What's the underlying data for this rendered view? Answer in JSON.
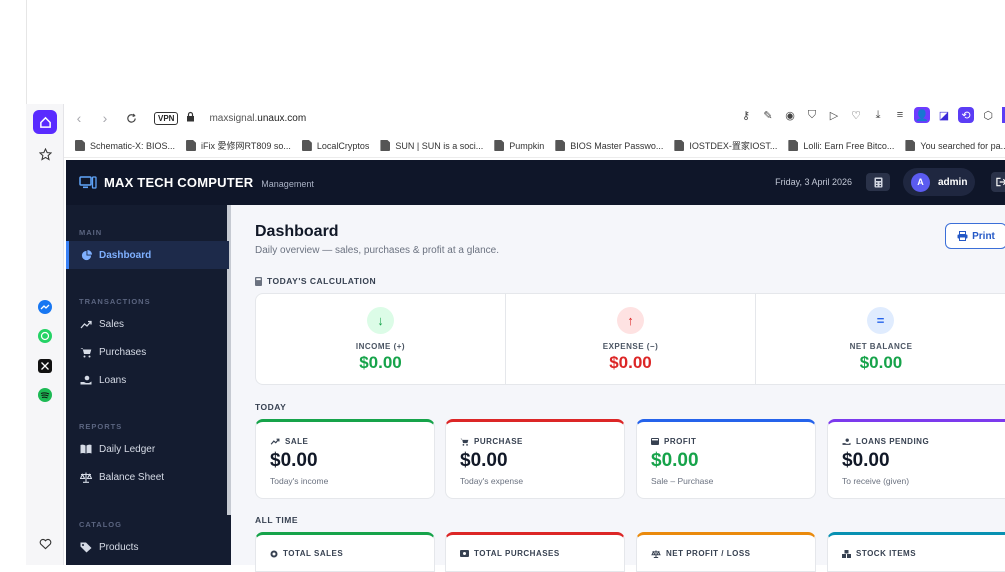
{
  "browser": {
    "vpn_label": "VPN",
    "url_prefix": "maxsignal.",
    "url_domain": "unaux.com",
    "bookmarks": [
      {
        "label": "Schematic-X: BIOS..."
      },
      {
        "label": "iFix 愛修网RT809 so..."
      },
      {
        "label": "LocalCryptos"
      },
      {
        "label": "SUN | SUN is a soci..."
      },
      {
        "label": "Pumpkin"
      },
      {
        "label": "BIOS Master Passwo..."
      },
      {
        "label": "IOSTDEX-置家IOST..."
      },
      {
        "label": "Lolli: Earn Free Bitco..."
      },
      {
        "label": "You searched for pa..."
      }
    ]
  },
  "header": {
    "brand": "MAX TECH COMPUTER",
    "brand_sub": "Management",
    "date": "Friday, 3 April 2026",
    "avatar_letter": "A",
    "username": "admin"
  },
  "sidebar": {
    "sections": {
      "main": "MAIN",
      "transactions": "TRANSACTIONS",
      "reports": "REPORTS",
      "catalog": "CATALOG"
    },
    "items": [
      {
        "label": "Dashboard",
        "icon": "pie-chart-icon",
        "active": true
      },
      {
        "label": "Sales",
        "icon": "trend-up-icon"
      },
      {
        "label": "Purchases",
        "icon": "cart-icon"
      },
      {
        "label": "Loans",
        "icon": "hand-coin-icon"
      },
      {
        "label": "Daily Ledger",
        "icon": "book-icon"
      },
      {
        "label": "Balance Sheet",
        "icon": "scale-icon"
      },
      {
        "label": "Products",
        "icon": "tag-icon"
      }
    ]
  },
  "main": {
    "title": "Dashboard",
    "subtitle": "Daily overview — sales, purchases & profit at a glance.",
    "print_label": "Print",
    "calc_heading": "TODAY'S CALCULATION",
    "calc": [
      {
        "label": "INCOME (+)",
        "value": "$0.00",
        "symbol": "↓",
        "color": "#16a34a",
        "bg": "#dcfce7"
      },
      {
        "label": "EXPENSE (−)",
        "value": "$0.00",
        "symbol": "↑",
        "color": "#dc2626",
        "bg": "#fee2e2"
      },
      {
        "label": "NET BALANCE",
        "value": "$0.00",
        "symbol": "=",
        "color": "#16a34a",
        "bg": "#e0ecfe"
      }
    ],
    "today_heading": "TODAY",
    "today_cards": [
      {
        "title": "SALE",
        "value": "$0.00",
        "sub": "Today's income",
        "accent": "#16a34a"
      },
      {
        "title": "PURCHASE",
        "value": "$0.00",
        "sub": "Today's expense",
        "accent": "#dc2626"
      },
      {
        "title": "PROFIT",
        "value": "$0.00",
        "sub": "Sale – Purchase",
        "accent": "#2563eb"
      },
      {
        "title": "LOANS PENDING",
        "value": "$0.00",
        "sub": "To receive (given)",
        "accent": "#7c3aed"
      }
    ],
    "alltime_heading": "ALL TIME",
    "alltime_cards": [
      {
        "title": "TOTAL SALES",
        "accent": "#16a34a"
      },
      {
        "title": "TOTAL PURCHASES",
        "accent": "#dc2626"
      },
      {
        "title": "NET PROFIT / LOSS",
        "accent": "#ea8a0c"
      },
      {
        "title": "STOCK ITEMS",
        "accent": "#0891b2"
      }
    ]
  }
}
